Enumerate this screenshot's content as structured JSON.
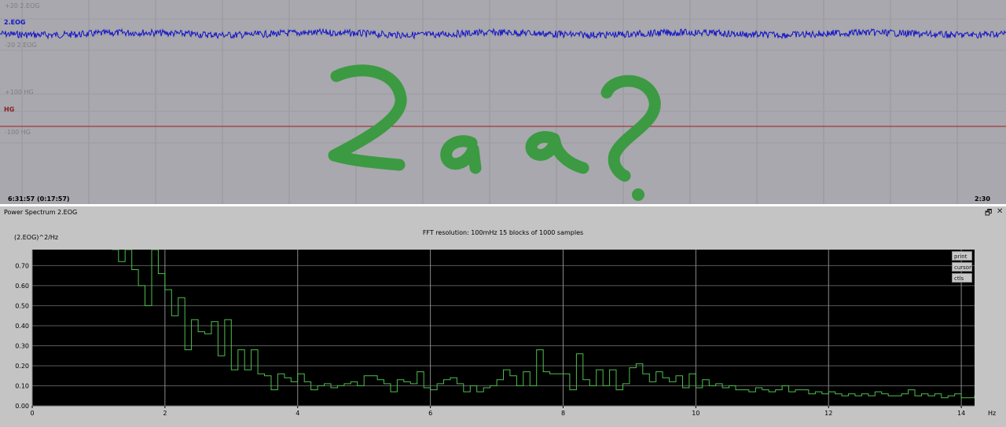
{
  "trace_panel": {
    "eog_upper": "+20 2.EOG",
    "eog_channel": "2.EOG",
    "eog_lower": "-20 2.EOG",
    "hg_upper": "+100 HG",
    "hg_channel": "HG",
    "hg_lower": "-100 HG",
    "time_left": "6:31:57 (0:17:57)",
    "time_right": "2:30",
    "annotation": "2ая?",
    "colors": {
      "eog": "#1414c8",
      "hg": "#a01c1c",
      "annotation": "#3c9a42"
    }
  },
  "spectrum_panel": {
    "title": "Power Spectrum 2.EOG",
    "restore_icon": "restore-window-icon",
    "close_icon": "close-icon",
    "fft_info": "FFT resolution: 100mHz   15 blocks of 1000 samples",
    "y_unit": "(2.EOG)^2/Hz",
    "buttons": {
      "print": "print",
      "cursor": "cursor",
      "ctls": "ctls"
    }
  },
  "chart_data": {
    "type": "line",
    "step": true,
    "xlabel": "Hz",
    "ylabel": "(2.EOG)^2/Hz",
    "xlim": [
      0,
      14.2
    ],
    "ylim": [
      0,
      0.78
    ],
    "x_ticks": [
      0,
      2,
      4,
      6,
      8,
      10,
      12,
      14
    ],
    "y_ticks": [
      0.0,
      0.1,
      0.2,
      0.3,
      0.4,
      0.5,
      0.6,
      0.7
    ],
    "x_tick_labels": [
      "0",
      "2",
      "4",
      "6",
      "8",
      "10",
      "12",
      "14"
    ],
    "y_tick_labels": [
      "0.00",
      "0.10",
      "0.20",
      "0.30",
      "0.40",
      "0.50",
      "0.60",
      "0.70"
    ],
    "grid": true,
    "line_color": "#4cc04c",
    "bin_width": 0.1,
    "x_start": 1.2,
    "values": [
      0.78,
      0.72,
      0.78,
      0.68,
      0.6,
      0.5,
      0.78,
      0.66,
      0.58,
      0.45,
      0.54,
      0.28,
      0.43,
      0.37,
      0.36,
      0.42,
      0.25,
      0.43,
      0.18,
      0.28,
      0.18,
      0.28,
      0.16,
      0.15,
      0.08,
      0.16,
      0.14,
      0.12,
      0.16,
      0.12,
      0.08,
      0.1,
      0.11,
      0.09,
      0.1,
      0.11,
      0.12,
      0.1,
      0.15,
      0.15,
      0.13,
      0.11,
      0.07,
      0.13,
      0.12,
      0.11,
      0.17,
      0.09,
      0.08,
      0.11,
      0.13,
      0.14,
      0.11,
      0.07,
      0.1,
      0.07,
      0.09,
      0.1,
      0.13,
      0.18,
      0.15,
      0.1,
      0.17,
      0.1,
      0.28,
      0.17,
      0.16,
      0.16,
      0.16,
      0.08,
      0.26,
      0.13,
      0.1,
      0.18,
      0.1,
      0.18,
      0.08,
      0.11,
      0.19,
      0.21,
      0.16,
      0.12,
      0.17,
      0.14,
      0.12,
      0.15,
      0.09,
      0.16,
      0.09,
      0.13,
      0.1,
      0.11,
      0.09,
      0.1,
      0.08,
      0.08,
      0.07,
      0.09,
      0.08,
      0.07,
      0.08,
      0.1,
      0.07,
      0.08,
      0.08,
      0.06,
      0.07,
      0.06,
      0.07,
      0.06,
      0.05,
      0.06,
      0.05,
      0.06,
      0.05,
      0.07,
      0.06,
      0.05,
      0.05,
      0.06,
      0.08,
      0.05,
      0.06,
      0.05,
      0.06,
      0.04,
      0.05,
      0.06,
      0.04,
      0.04,
      0.05
    ]
  }
}
